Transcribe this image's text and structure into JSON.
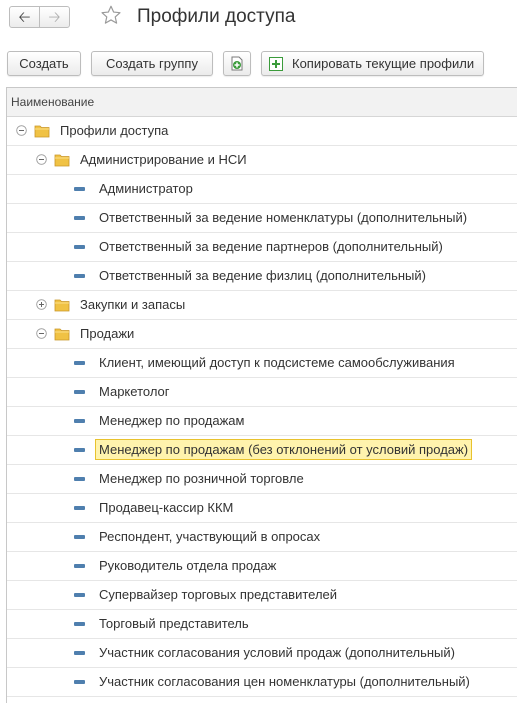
{
  "header": {
    "title": "Профили доступа",
    "back_icon": "arrow-left-icon",
    "forward_icon": "arrow-right-icon",
    "favorite_icon": "star-icon"
  },
  "toolbar": {
    "create_label": "Создать",
    "create_group_label": "Создать группу",
    "copy_profiles_label": "Копировать текущие профили"
  },
  "table": {
    "column_header": "Наименование",
    "rows": [
      {
        "label": "Профили доступа",
        "type": "folder",
        "expanded": true,
        "level": 0
      },
      {
        "label": "Администрирование и НСИ",
        "type": "folder",
        "expanded": true,
        "level": 1
      },
      {
        "label": "Администратор",
        "type": "item",
        "level": 2
      },
      {
        "label": "Ответственный за ведение номенклатуры (дополнительный)",
        "type": "item",
        "level": 2
      },
      {
        "label": "Ответственный за ведение партнеров (дополнительный)",
        "type": "item",
        "level": 2
      },
      {
        "label": "Ответственный за ведение физлиц (дополнительный)",
        "type": "item",
        "level": 2
      },
      {
        "label": "Закупки и запасы",
        "type": "folder",
        "expanded": false,
        "level": 1
      },
      {
        "label": "Продажи",
        "type": "folder",
        "expanded": true,
        "level": 1
      },
      {
        "label": "Клиент, имеющий доступ к подсистеме самообслуживания",
        "type": "item",
        "level": 2
      },
      {
        "label": "Маркетолог",
        "type": "item",
        "level": 2
      },
      {
        "label": "Менеджер по продажам",
        "type": "item",
        "level": 2
      },
      {
        "label": "Менеджер по продажам (без отклонений от условий продаж)",
        "type": "item",
        "level": 2,
        "selected": true
      },
      {
        "label": "Менеджер по розничной торговле",
        "type": "item",
        "level": 2
      },
      {
        "label": "Продавец-кассир ККМ",
        "type": "item",
        "level": 2
      },
      {
        "label": "Респондент, участвующий в опросах",
        "type": "item",
        "level": 2
      },
      {
        "label": "Руководитель отдела продаж",
        "type": "item",
        "level": 2
      },
      {
        "label": "Супервайзер торговых представителей",
        "type": "item",
        "level": 2
      },
      {
        "label": "Торговый представитель",
        "type": "item",
        "level": 2
      },
      {
        "label": "Участник согласования условий продаж (дополнительный)",
        "type": "item",
        "level": 2
      },
      {
        "label": "Участник согласования цен номенклатуры (дополнительный)",
        "type": "item",
        "level": 2
      }
    ]
  },
  "colors": {
    "selection_fill": "#fff3ad",
    "selection_border": "#e8c22e",
    "folder": "#f0c244",
    "item_icon": "#4f7fae",
    "copy_icon": "#3a9b3a"
  }
}
